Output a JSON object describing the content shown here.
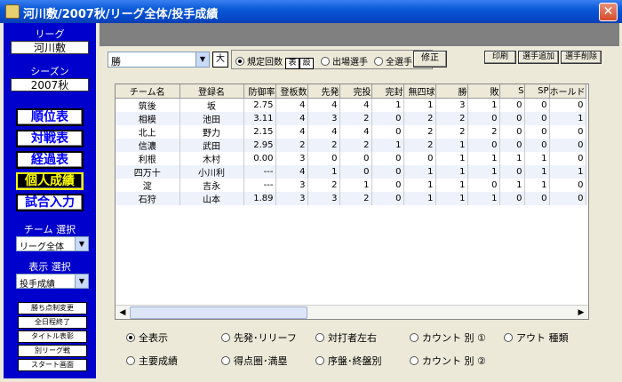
{
  "window": {
    "title": "河川敷/2007秋/リーグ全体/投手成績",
    "close_label": "✕"
  },
  "sidebar": {
    "league_label": "リーグ",
    "league_value": "河川敷",
    "season_label": "シーズン",
    "season_value": "2007秋",
    "nav": [
      {
        "label": "順位表"
      },
      {
        "label": "対戦表"
      },
      {
        "label": "経過表"
      },
      {
        "label": "個人成績"
      },
      {
        "label": "試合入力"
      }
    ],
    "team_select_label": "チーム 選択",
    "team_select_value": "リーグ全体",
    "display_select_label": "表示 選択",
    "display_select_value": "投手成績",
    "small_buttons": [
      {
        "label": "勝ち点制変更"
      },
      {
        "label": "全日程終了"
      },
      {
        "label": "タイトル表彰"
      },
      {
        "label": "別リーグ戦"
      },
      {
        "label": "スタート画面"
      }
    ]
  },
  "toolbar": {
    "sort_value": "勝",
    "large_button": "大",
    "radio_regular": "規定回数",
    "radio_regular_inline1": "表",
    "radio_regular_inline2": "設",
    "radio_appeared": "出場選手",
    "radio_all": "全選手",
    "fix_button": "修正",
    "print_button": "印刷",
    "add_player_button": "選手追加",
    "delete_player_button": "選手削除"
  },
  "grid": {
    "headers": [
      "チーム名",
      "登録名",
      "防御率",
      "登板数",
      "先発",
      "完投",
      "完封",
      "無四球",
      "勝",
      "敗",
      "S",
      "SP",
      "ホールド"
    ],
    "rows": [
      [
        "筑後",
        "坂",
        "2.75",
        "4",
        "4",
        "4",
        "1",
        "1",
        "3",
        "1",
        "0",
        "0",
        "0"
      ],
      [
        "相模",
        "池田",
        "3.11",
        "4",
        "3",
        "2",
        "0",
        "2",
        "2",
        "0",
        "0",
        "0",
        "1"
      ],
      [
        "北上",
        "野力",
        "2.15",
        "4",
        "4",
        "4",
        "0",
        "2",
        "2",
        "2",
        "0",
        "0",
        "0"
      ],
      [
        "信濃",
        "武田",
        "2.95",
        "2",
        "2",
        "2",
        "1",
        "2",
        "1",
        "0",
        "0",
        "0",
        "0"
      ],
      [
        "利根",
        "木村",
        "0.00",
        "3",
        "0",
        "0",
        "0",
        "0",
        "1",
        "1",
        "1",
        "1",
        "0"
      ],
      [
        "四万十",
        "小川利",
        "---",
        "4",
        "1",
        "0",
        "0",
        "1",
        "1",
        "1",
        "0",
        "1",
        "1"
      ],
      [
        "淀",
        "吉永",
        "---",
        "3",
        "2",
        "1",
        "0",
        "1",
        "1",
        "0",
        "1",
        "1",
        "0"
      ],
      [
        "石狩",
        "山本",
        "1.89",
        "3",
        "3",
        "2",
        "0",
        "1",
        "1",
        "1",
        "0",
        "0",
        "0"
      ]
    ]
  },
  "options": [
    {
      "label": "全表示",
      "checked": true
    },
    {
      "label": "先発･リリーフ",
      "checked": false
    },
    {
      "label": "対打者左右",
      "checked": false
    },
    {
      "label": "カウント 別 ①",
      "checked": false
    },
    {
      "label": "アウト 種類",
      "checked": false
    },
    {
      "label": "主要成績",
      "checked": false
    },
    {
      "label": "得点圏･満塁",
      "checked": false
    },
    {
      "label": "序盤･終盤別",
      "checked": false
    },
    {
      "label": "カウント 別 ②",
      "checked": false
    }
  ],
  "colors": {
    "sidebar_bg": "#0000cc",
    "active_nav_bg": "#000000",
    "active_nav_text": "#ffff00",
    "nav_text": "#0000ff"
  }
}
